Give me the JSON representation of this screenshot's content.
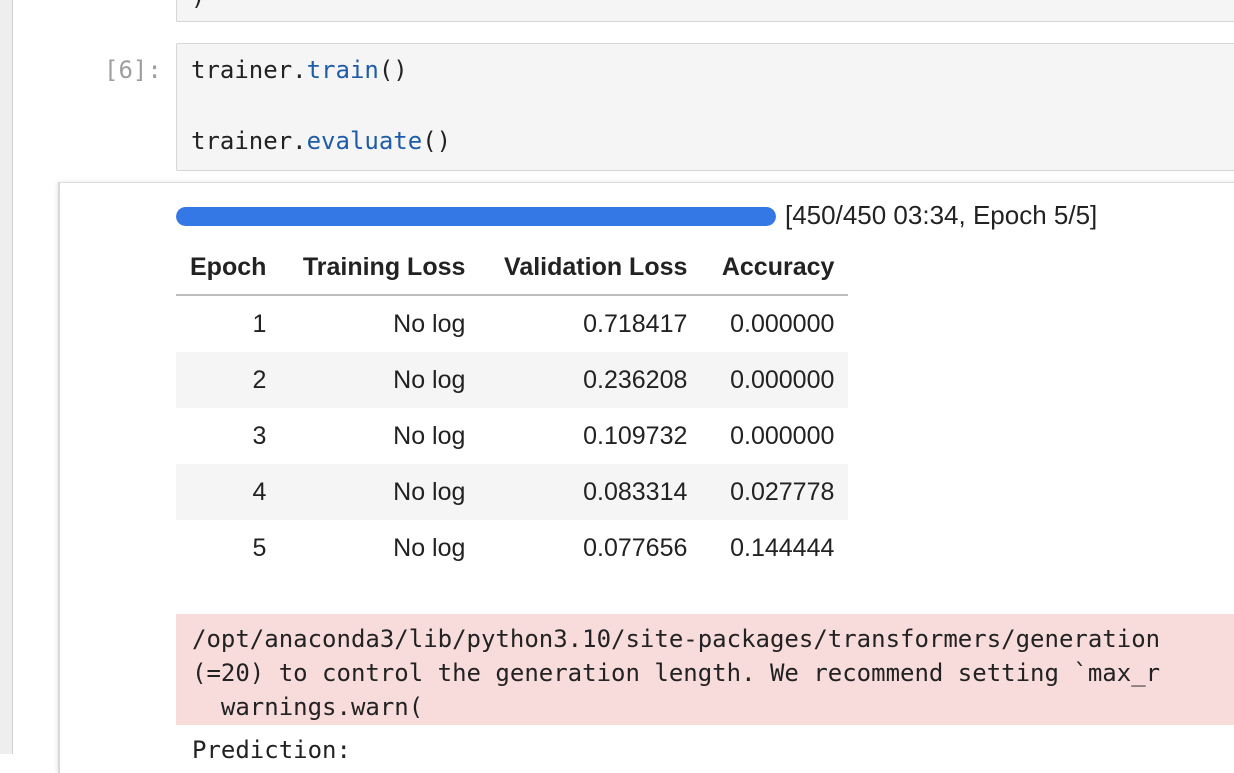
{
  "previous_cell": {
    "code_tail": ")"
  },
  "cell": {
    "prompt": "[6]:",
    "code": [
      {
        "object": "trainer.",
        "method": "train",
        "args": "()"
      },
      {
        "object": "trainer.",
        "method": "evaluate",
        "args": "()"
      }
    ]
  },
  "output": {
    "progress": {
      "fraction": 1.0,
      "label": "[450/450 03:34, Epoch 5/5]"
    },
    "table": {
      "headers": [
        "Epoch",
        "Training Loss",
        "Validation Loss",
        "Accuracy"
      ],
      "rows": [
        [
          "1",
          "No log",
          "0.718417",
          "0.000000"
        ],
        [
          "2",
          "No log",
          "0.236208",
          "0.000000"
        ],
        [
          "3",
          "No log",
          "0.109732",
          "0.000000"
        ],
        [
          "4",
          "No log",
          "0.083314",
          "0.027778"
        ],
        [
          "5",
          "No log",
          "0.077656",
          "0.144444"
        ]
      ]
    },
    "stderr": [
      "/opt/anaconda3/lib/python3.10/site-packages/transformers/generation",
      "(=20) to control the generation length. We recommend setting `max_r",
      "  warnings.warn("
    ],
    "stdout_partial": "Prediction:"
  },
  "colors": {
    "progress_fill": "#3478e6",
    "stderr_background": "#f8dcdc",
    "method_token": "#1f5ca8"
  }
}
